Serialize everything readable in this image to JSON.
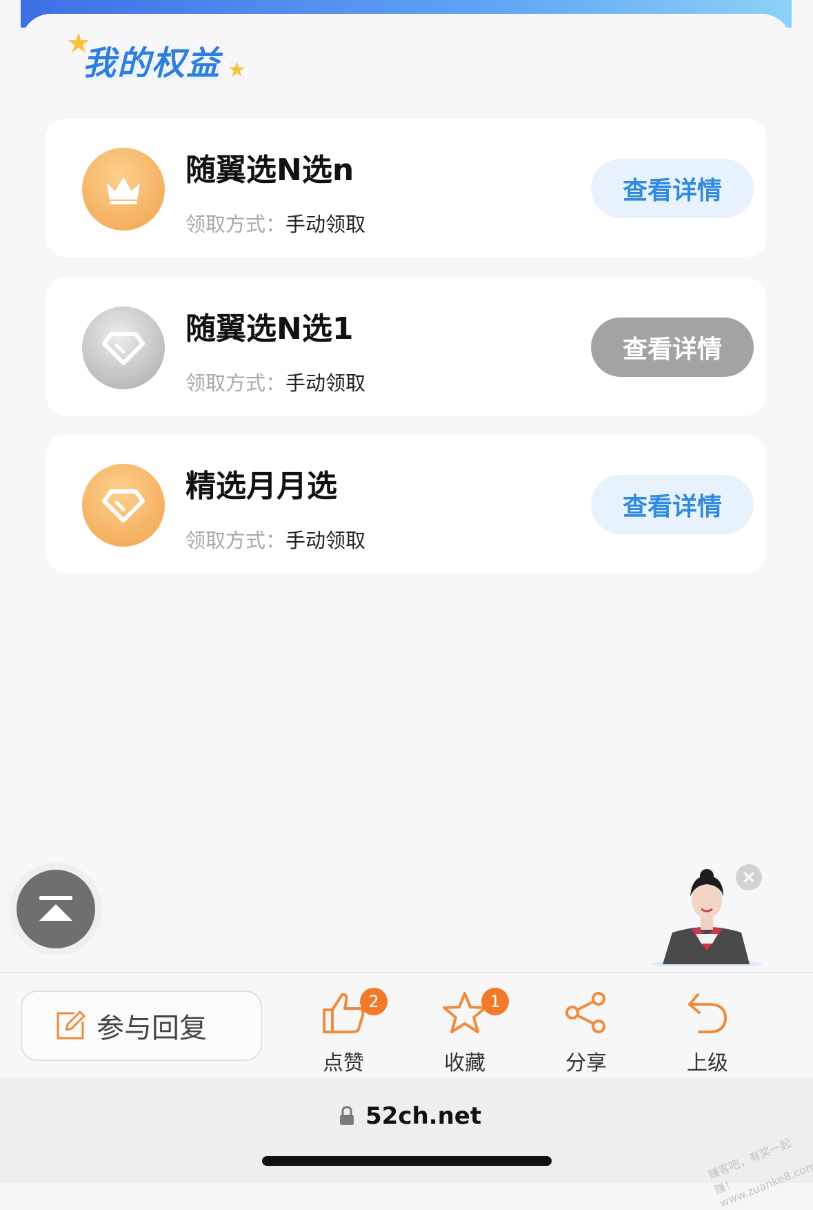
{
  "section": {
    "title": "我的权益"
  },
  "cards": [
    {
      "title": "随翼选N选n",
      "meta_label": "领取方式：",
      "meta_value": "手动领取",
      "button": "查看详情",
      "icon": "crown-icon",
      "state": "active"
    },
    {
      "title": "随翼选N选1",
      "meta_label": "领取方式：",
      "meta_value": "手动领取",
      "button": "查看详情",
      "icon": "diamond-icon",
      "state": "disabled"
    },
    {
      "title": "精选月月选",
      "meta_label": "领取方式：",
      "meta_value": "手动领取",
      "button": "查看详情",
      "icon": "diamond-icon",
      "state": "active"
    }
  ],
  "toolbar": {
    "reply": "参与回复",
    "items": [
      {
        "label": "点赞",
        "icon": "thumbs-up-icon",
        "count": "2"
      },
      {
        "label": "收藏",
        "icon": "star-icon",
        "count": "1"
      },
      {
        "label": "分享",
        "icon": "share-icon"
      },
      {
        "label": "上级",
        "icon": "back-arrow-icon"
      }
    ]
  },
  "browser": {
    "url": "52ch.net"
  },
  "watermark": "赚客吧，有奖一起赚！ www.zuanke8.com",
  "colors": {
    "accent_blue": "#2f8ae0",
    "badge_orange": "#f3a24e",
    "count_badge": "#f07a2a",
    "disabled_gray": "#a3a3a3"
  }
}
